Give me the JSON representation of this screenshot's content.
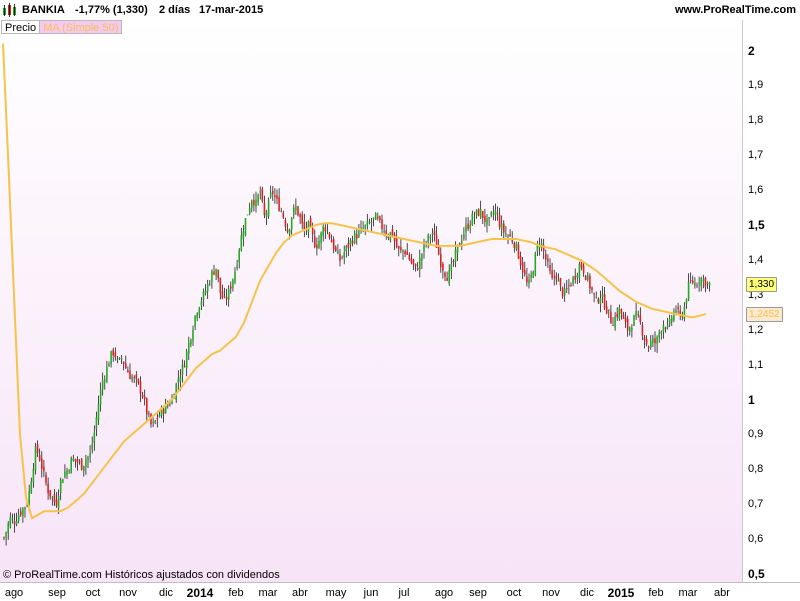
{
  "header": {
    "symbol": "BANKIA",
    "change": "-1,77% (1,330)",
    "timeframe": "2 días",
    "date": "17-mar-2015",
    "site": "www.ProRealTime.com"
  },
  "legend": {
    "price_label": "Precio",
    "ma_label": "MA (Simple 50)"
  },
  "footer": {
    "text": "© ProRealTime.com  Históricos ajustados con dividendos"
  },
  "colors": {
    "up": "#22aa22",
    "down": "#dd2222",
    "ma": "#f6c34a",
    "price_tag_bg": "#ffff7a",
    "ma_tag_bg": "#fde8d0"
  },
  "chart_data": {
    "type": "candlestick",
    "y_ticks": [
      "2",
      "1,9",
      "1,8",
      "1,7",
      "1,6",
      "1,5",
      "1,4",
      "1,3",
      "1,2",
      "1,1",
      "1",
      "0,9",
      "0,8",
      "0,7",
      "0,6",
      "0,5"
    ],
    "y_major": [
      "2",
      "1,5",
      "1",
      "0,5"
    ],
    "ylim": [
      0.5,
      2.05
    ],
    "x_ticks": [
      "ago",
      "sep",
      "oct",
      "nov",
      "dic",
      "2014",
      "feb",
      "mar",
      "abr",
      "may",
      "jun",
      "jul",
      "ago",
      "sep",
      "oct",
      "nov",
      "dic",
      "2015",
      "feb",
      "mar",
      "abr"
    ],
    "x_year_ticks": [
      "2014",
      "2015"
    ],
    "last_price": "1,330",
    "last_ma": "1,2452",
    "close_path": [
      [
        0,
        0.57
      ],
      [
        6,
        0.62
      ],
      [
        10,
        0.66
      ],
      [
        14,
        0.65
      ],
      [
        18,
        0.67
      ],
      [
        24,
        0.69
      ],
      [
        28,
        0.71
      ],
      [
        32,
        0.79
      ],
      [
        36,
        0.86
      ],
      [
        40,
        0.83
      ],
      [
        44,
        0.78
      ],
      [
        48,
        0.74
      ],
      [
        52,
        0.72
      ],
      [
        56,
        0.7
      ],
      [
        60,
        0.76
      ],
      [
        64,
        0.79
      ],
      [
        68,
        0.8
      ],
      [
        72,
        0.83
      ],
      [
        78,
        0.82
      ],
      [
        82,
        0.81
      ],
      [
        86,
        0.83
      ],
      [
        90,
        0.84
      ],
      [
        94,
        0.9
      ],
      [
        98,
        0.98
      ],
      [
        102,
        1.05
      ],
      [
        106,
        1.08
      ],
      [
        110,
        1.12
      ],
      [
        114,
        1.14
      ],
      [
        118,
        1.1
      ],
      [
        122,
        1.12
      ],
      [
        126,
        1.09
      ],
      [
        130,
        1.07
      ],
      [
        136,
        1.05
      ],
      [
        142,
        1.02
      ],
      [
        148,
        0.95
      ],
      [
        152,
        0.92
      ],
      [
        156,
        0.94
      ],
      [
        160,
        0.96
      ],
      [
        166,
        0.98
      ],
      [
        172,
        1.0
      ],
      [
        178,
        1.06
      ],
      [
        184,
        1.1
      ],
      [
        188,
        1.15
      ],
      [
        192,
        1.2
      ],
      [
        196,
        1.25
      ],
      [
        200,
        1.28
      ],
      [
        204,
        1.3
      ],
      [
        208,
        1.33
      ],
      [
        212,
        1.36
      ],
      [
        216,
        1.38
      ],
      [
        220,
        1.31
      ],
      [
        224,
        1.28
      ],
      [
        228,
        1.3
      ],
      [
        232,
        1.34
      ],
      [
        236,
        1.38
      ],
      [
        240,
        1.45
      ],
      [
        244,
        1.5
      ],
      [
        248,
        1.54
      ],
      [
        252,
        1.58
      ],
      [
        256,
        1.56
      ],
      [
        260,
        1.6
      ],
      [
        264,
        1.52
      ],
      [
        268,
        1.55
      ],
      [
        272,
        1.6
      ],
      [
        276,
        1.57
      ],
      [
        280,
        1.55
      ],
      [
        284,
        1.52
      ],
      [
        288,
        1.48
      ],
      [
        292,
        1.53
      ],
      [
        296,
        1.55
      ],
      [
        300,
        1.52
      ],
      [
        304,
        1.48
      ],
      [
        308,
        1.5
      ],
      [
        312,
        1.47
      ],
      [
        316,
        1.44
      ],
      [
        320,
        1.46
      ],
      [
        324,
        1.5
      ],
      [
        328,
        1.48
      ],
      [
        332,
        1.45
      ],
      [
        336,
        1.42
      ],
      [
        340,
        1.4
      ],
      [
        344,
        1.42
      ],
      [
        348,
        1.44
      ],
      [
        352,
        1.46
      ],
      [
        356,
        1.47
      ],
      [
        360,
        1.48
      ],
      [
        364,
        1.49
      ],
      [
        368,
        1.5
      ],
      [
        372,
        1.51
      ],
      [
        376,
        1.52
      ],
      [
        380,
        1.5
      ],
      [
        384,
        1.49
      ],
      [
        388,
        1.47
      ],
      [
        392,
        1.48
      ],
      [
        396,
        1.44
      ],
      [
        400,
        1.42
      ],
      [
        404,
        1.43
      ],
      [
        408,
        1.41
      ],
      [
        412,
        1.39
      ],
      [
        416,
        1.37
      ],
      [
        420,
        1.4
      ],
      [
        424,
        1.44
      ],
      [
        428,
        1.46
      ],
      [
        432,
        1.48
      ],
      [
        436,
        1.45
      ],
      [
        440,
        1.4
      ],
      [
        444,
        1.37
      ],
      [
        448,
        1.35
      ],
      [
        452,
        1.38
      ],
      [
        456,
        1.42
      ],
      [
        460,
        1.45
      ],
      [
        464,
        1.48
      ],
      [
        468,
        1.5
      ],
      [
        472,
        1.52
      ],
      [
        476,
        1.53
      ],
      [
        480,
        1.54
      ],
      [
        484,
        1.52
      ],
      [
        488,
        1.5
      ],
      [
        492,
        1.53
      ],
      [
        496,
        1.54
      ],
      [
        500,
        1.5
      ],
      [
        504,
        1.48
      ],
      [
        508,
        1.47
      ],
      [
        512,
        1.46
      ],
      [
        516,
        1.44
      ],
      [
        520,
        1.4
      ],
      [
        524,
        1.36
      ],
      [
        528,
        1.32
      ],
      [
        532,
        1.36
      ],
      [
        536,
        1.42
      ],
      [
        540,
        1.46
      ],
      [
        544,
        1.42
      ],
      [
        548,
        1.38
      ],
      [
        552,
        1.34
      ],
      [
        556,
        1.36
      ],
      [
        560,
        1.32
      ],
      [
        564,
        1.3
      ],
      [
        568,
        1.32
      ],
      [
        572,
        1.34
      ],
      [
        576,
        1.36
      ],
      [
        580,
        1.39
      ],
      [
        584,
        1.37
      ],
      [
        588,
        1.34
      ],
      [
        592,
        1.31
      ],
      [
        596,
        1.28
      ],
      [
        600,
        1.3
      ],
      [
        604,
        1.28
      ],
      [
        608,
        1.25
      ],
      [
        612,
        1.22
      ],
      [
        616,
        1.24
      ],
      [
        620,
        1.26
      ],
      [
        624,
        1.22
      ],
      [
        628,
        1.2
      ],
      [
        632,
        1.22
      ],
      [
        636,
        1.24
      ],
      [
        640,
        1.22
      ],
      [
        644,
        1.18
      ],
      [
        648,
        1.15
      ],
      [
        652,
        1.17
      ],
      [
        656,
        1.16
      ],
      [
        660,
        1.2
      ],
      [
        664,
        1.22
      ],
      [
        668,
        1.2
      ],
      [
        672,
        1.24
      ],
      [
        676,
        1.26
      ],
      [
        680,
        1.23
      ],
      [
        684,
        1.26
      ],
      [
        688,
        1.32
      ],
      [
        692,
        1.34
      ],
      [
        696,
        1.33
      ],
      [
        700,
        1.35
      ],
      [
        704,
        1.34
      ],
      [
        708,
        1.33
      ]
    ],
    "ma_path": [
      [
        3,
        2.02
      ],
      [
        8,
        1.7
      ],
      [
        14,
        1.3
      ],
      [
        20,
        0.9
      ],
      [
        26,
        0.72
      ],
      [
        32,
        0.66
      ],
      [
        38,
        0.67
      ],
      [
        44,
        0.68
      ],
      [
        52,
        0.68
      ],
      [
        60,
        0.68
      ],
      [
        68,
        0.69
      ],
      [
        76,
        0.71
      ],
      [
        84,
        0.73
      ],
      [
        92,
        0.76
      ],
      [
        100,
        0.79
      ],
      [
        108,
        0.82
      ],
      [
        116,
        0.85
      ],
      [
        124,
        0.88
      ],
      [
        132,
        0.9
      ],
      [
        140,
        0.92
      ],
      [
        148,
        0.94
      ],
      [
        156,
        0.96
      ],
      [
        164,
        0.98
      ],
      [
        172,
        1.0
      ],
      [
        180,
        1.03
      ],
      [
        188,
        1.06
      ],
      [
        196,
        1.09
      ],
      [
        204,
        1.11
      ],
      [
        212,
        1.13
      ],
      [
        220,
        1.14
      ],
      [
        228,
        1.16
      ],
      [
        236,
        1.18
      ],
      [
        244,
        1.22
      ],
      [
        252,
        1.28
      ],
      [
        260,
        1.34
      ],
      [
        268,
        1.38
      ],
      [
        276,
        1.42
      ],
      [
        284,
        1.45
      ],
      [
        292,
        1.47
      ],
      [
        300,
        1.48
      ],
      [
        308,
        1.49
      ],
      [
        316,
        1.5
      ],
      [
        324,
        1.505
      ],
      [
        332,
        1.505
      ],
      [
        340,
        1.5
      ],
      [
        348,
        1.495
      ],
      [
        356,
        1.49
      ],
      [
        364,
        1.485
      ],
      [
        372,
        1.48
      ],
      [
        380,
        1.475
      ],
      [
        388,
        1.47
      ],
      [
        396,
        1.465
      ],
      [
        404,
        1.46
      ],
      [
        412,
        1.455
      ],
      [
        420,
        1.45
      ],
      [
        428,
        1.445
      ],
      [
        436,
        1.44
      ],
      [
        444,
        1.44
      ],
      [
        452,
        1.44
      ],
      [
        460,
        1.44
      ],
      [
        468,
        1.445
      ],
      [
        476,
        1.45
      ],
      [
        484,
        1.455
      ],
      [
        492,
        1.46
      ],
      [
        500,
        1.46
      ],
      [
        508,
        1.46
      ],
      [
        516,
        1.46
      ],
      [
        524,
        1.455
      ],
      [
        532,
        1.45
      ],
      [
        540,
        1.44
      ],
      [
        548,
        1.435
      ],
      [
        556,
        1.43
      ],
      [
        564,
        1.42
      ],
      [
        572,
        1.41
      ],
      [
        580,
        1.4
      ],
      [
        588,
        1.385
      ],
      [
        596,
        1.37
      ],
      [
        604,
        1.35
      ],
      [
        612,
        1.33
      ],
      [
        620,
        1.31
      ],
      [
        628,
        1.295
      ],
      [
        636,
        1.28
      ],
      [
        644,
        1.27
      ],
      [
        652,
        1.26
      ],
      [
        660,
        1.255
      ],
      [
        668,
        1.25
      ],
      [
        676,
        1.245
      ],
      [
        684,
        1.24
      ],
      [
        692,
        1.235
      ],
      [
        700,
        1.24
      ],
      [
        706,
        1.2452
      ]
    ]
  }
}
